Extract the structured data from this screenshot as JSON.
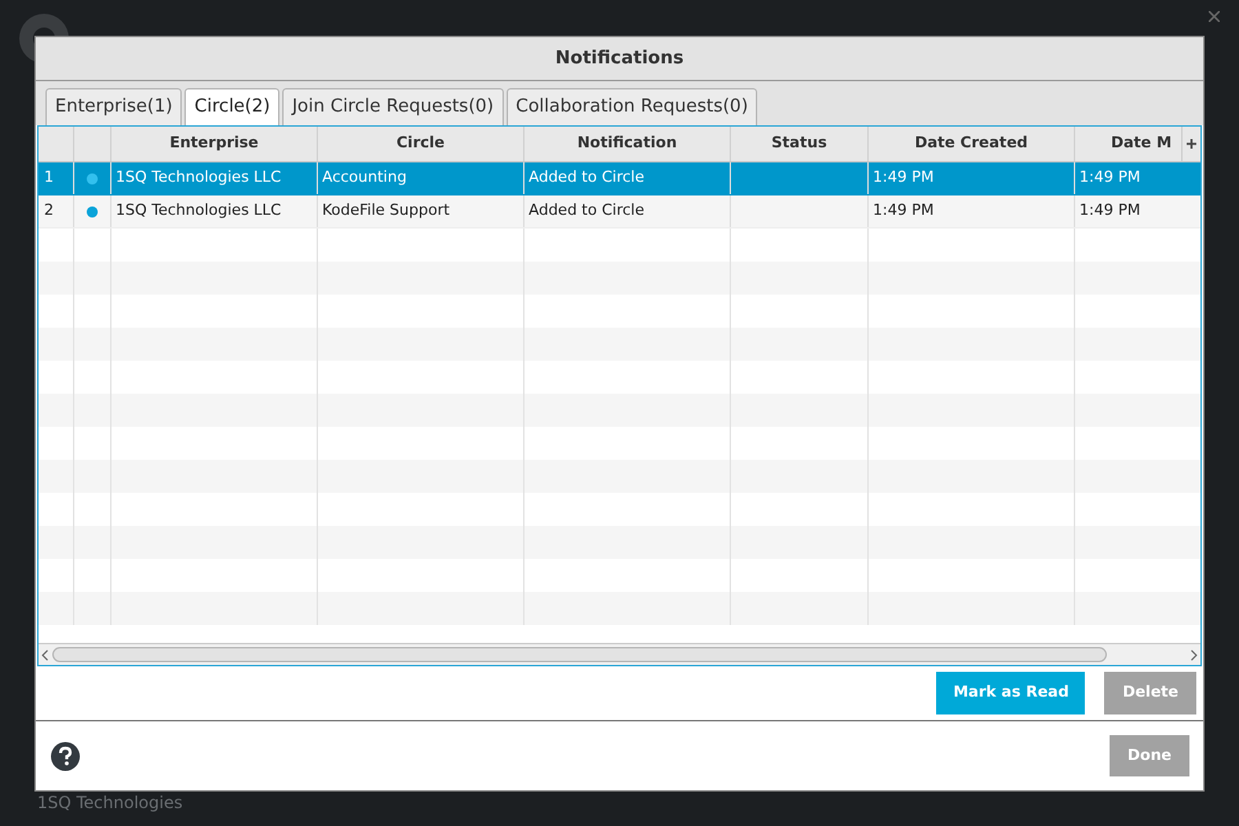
{
  "window": {
    "title": "Notifications"
  },
  "tabs": [
    {
      "label": "Enterprise(1)",
      "selected": false
    },
    {
      "label": "Circle(2)",
      "selected": true
    },
    {
      "label": "Join Circle Requests(0)",
      "selected": false
    },
    {
      "label": "Collaboration Requests(0)",
      "selected": false
    }
  ],
  "table": {
    "columns": [
      "Enterprise",
      "Circle",
      "Notification",
      "Status",
      "Date Created",
      "Date M"
    ],
    "rows": [
      {
        "number": "1",
        "unread": true,
        "selected": true,
        "cells": [
          "1SQ Technologies LLC",
          "Accounting",
          "Added to Circle",
          "",
          "1:49 PM",
          "1:49 PM"
        ]
      },
      {
        "number": "2",
        "unread": true,
        "selected": false,
        "cells": [
          "1SQ Technologies LLC",
          "KodeFile Support",
          "Added to Circle",
          "",
          "1:49 PM",
          "1:49 PM"
        ]
      }
    ]
  },
  "actions": [
    "Mark as Read",
    "Delete"
  ],
  "footer_button": "Done",
  "background": {
    "company": "1SQ Technologies"
  }
}
